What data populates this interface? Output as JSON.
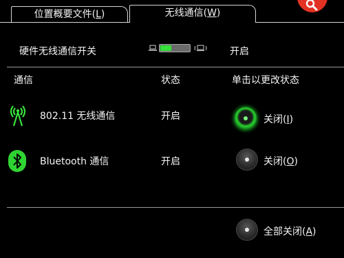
{
  "tabs": [
    {
      "label": "位置概要文件(",
      "key": "L",
      "suffix": ")"
    },
    {
      "label": "无线通信(",
      "key": "W",
      "suffix": ")"
    }
  ],
  "hardware_switch": {
    "label": "硬件无线通信开关",
    "status": "开启",
    "level": 0.38
  },
  "columns": {
    "device": "通信",
    "status": "状态",
    "action": "单击以更改状态"
  },
  "devices": [
    {
      "name": "802.11 无线通信",
      "status": "开启",
      "action": "关闭(",
      "key": "I",
      "suffix": ")",
      "icon": "wifi-icon",
      "selected": true
    },
    {
      "name": "Bluetooth 通信",
      "status": "开启",
      "action": "关闭(",
      "key": "O",
      "suffix": ")",
      "icon": "bluetooth-icon",
      "selected": false
    }
  ],
  "all_off": {
    "label": "全部关闭(",
    "key": "A",
    "suffix": ")"
  },
  "colors": {
    "accent": "#35e03a",
    "background": "#000000",
    "badge": "#e23224"
  }
}
